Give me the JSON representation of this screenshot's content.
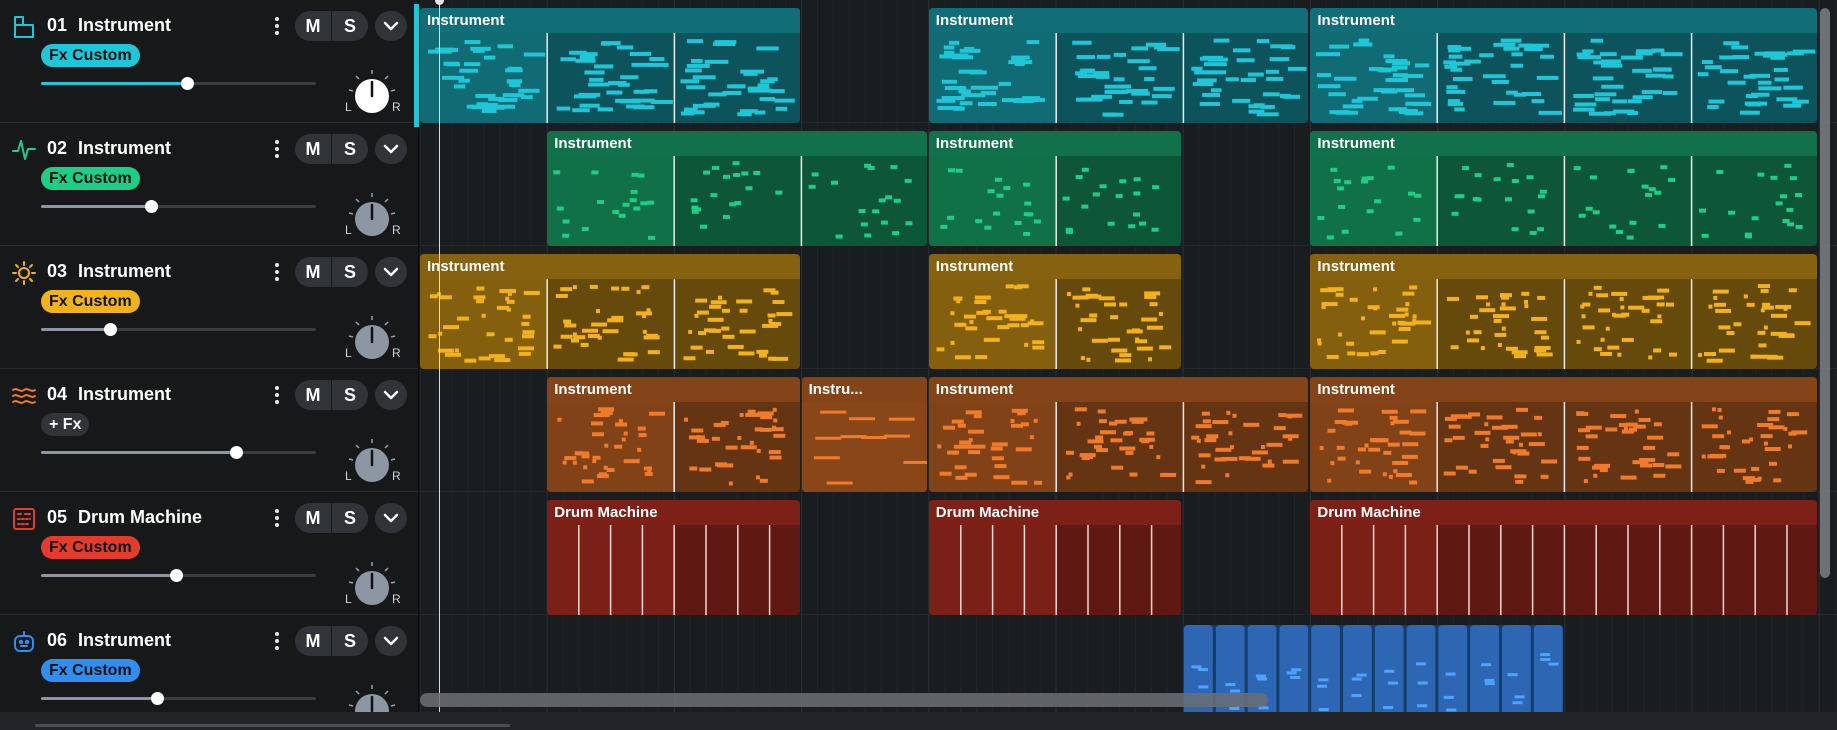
{
  "tracks": [
    {
      "number": "01",
      "name": "Instrument",
      "fx": "Fx Custom",
      "color": "#1fc6d8",
      "icon": "piano-icon",
      "volume": 0.53,
      "mute_label": "M",
      "solo_label": "S",
      "pan_left": "L",
      "pan_right": "R",
      "knob": "white"
    },
    {
      "number": "02",
      "name": "Instrument",
      "fx": "Fx Custom",
      "color": "#1fce86",
      "icon": "synth-wave-icon",
      "volume": 0.4,
      "mute_label": "M",
      "solo_label": "S",
      "pan_left": "L",
      "pan_right": "R",
      "knob": "gray"
    },
    {
      "number": "03",
      "name": "Instrument",
      "fx": "Fx Custom",
      "color": "#f3b11c",
      "icon": "sun-icon",
      "volume": 0.25,
      "mute_label": "M",
      "solo_label": "S",
      "pan_left": "L",
      "pan_right": "R",
      "knob": "gray"
    },
    {
      "number": "04",
      "name": "Instrument",
      "fx": "+ Fx",
      "color": "#f07b2a",
      "icon": "waves-icon",
      "volume": 0.71,
      "mute_label": "M",
      "solo_label": "S",
      "pan_left": "L",
      "pan_right": "R",
      "knob": "gray"
    },
    {
      "number": "05",
      "name": "Drum Machine",
      "fx": "Fx Custom",
      "color": "#e43b2c",
      "icon": "drum-machine-icon",
      "volume": 0.49,
      "mute_label": "M",
      "solo_label": "S",
      "pan_left": "L",
      "pan_right": "R",
      "knob": "gray"
    },
    {
      "number": "06",
      "name": "Instrument",
      "fx": "Fx Custom",
      "color": "#2f8ef0",
      "icon": "robot-face-icon",
      "volume": 0.42,
      "mute_label": "M",
      "solo_label": "S",
      "pan_left": "L",
      "pan_right": "R",
      "knob": "gray"
    }
  ],
  "clips": [
    {
      "track": 0,
      "start": 0,
      "bars": 3,
      "label": "Instrument",
      "kind": "keys"
    },
    {
      "track": 0,
      "start": 4,
      "bars": 3,
      "label": "Instrument",
      "kind": "keys"
    },
    {
      "track": 0,
      "start": 7,
      "bars": 4,
      "label": "Instrument",
      "kind": "keys"
    },
    {
      "track": 1,
      "start": 1,
      "bars": 3,
      "label": "Instrument",
      "kind": "sparse"
    },
    {
      "track": 1,
      "start": 4,
      "bars": 2,
      "label": "Instrument",
      "kind": "sparse"
    },
    {
      "track": 1,
      "start": 7,
      "bars": 4,
      "label": "Instrument",
      "kind": "sparse"
    },
    {
      "track": 2,
      "start": 0,
      "bars": 3,
      "label": "Instrument",
      "kind": "dots"
    },
    {
      "track": 2,
      "start": 4,
      "bars": 2,
      "label": "Instrument",
      "kind": "dots"
    },
    {
      "track": 2,
      "start": 7,
      "bars": 4,
      "label": "Instrument",
      "kind": "dots"
    },
    {
      "track": 3,
      "start": 1,
      "bars": 2,
      "label": "Instrument",
      "kind": "dots"
    },
    {
      "track": 3,
      "start": 3,
      "bars": 1,
      "label": "Instru...",
      "kind": "bold"
    },
    {
      "track": 3,
      "start": 4,
      "bars": 3,
      "label": "Instrument",
      "kind": "dots"
    },
    {
      "track": 3,
      "start": 7,
      "bars": 4,
      "label": "Instrument",
      "kind": "dots"
    },
    {
      "track": 4,
      "start": 1,
      "bars": 2,
      "label": "Drum Machine",
      "kind": "drums"
    },
    {
      "track": 4,
      "start": 4,
      "bars": 2,
      "label": "Drum Machine",
      "kind": "drums"
    },
    {
      "track": 4,
      "start": 7,
      "bars": 4,
      "label": "Drum Machine",
      "kind": "drums"
    },
    {
      "track": 5,
      "start": 6,
      "bars": 3,
      "label": "",
      "kind": "blocks"
    }
  ],
  "timeline": {
    "bar_count": 11,
    "playhead_bar": 0
  }
}
